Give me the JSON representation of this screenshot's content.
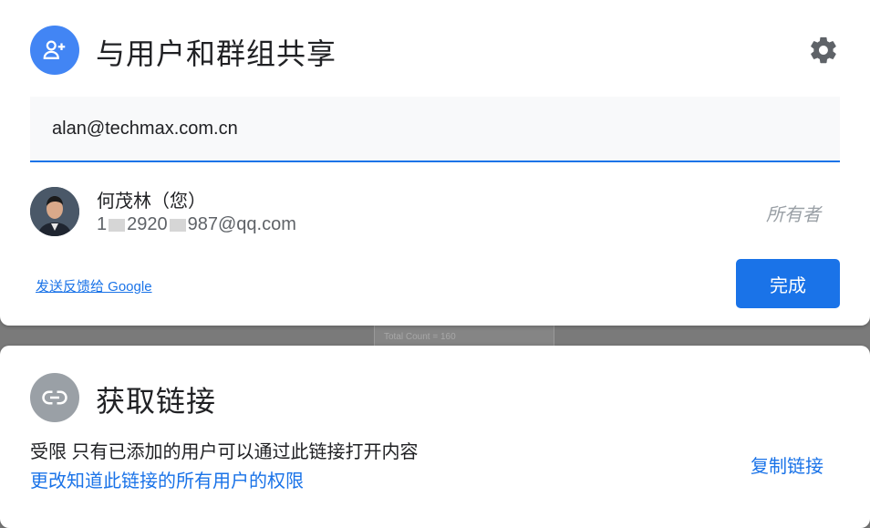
{
  "background_doc": {
    "text": "Total Count = 160"
  },
  "share": {
    "icon": "person-add-icon",
    "title": "与用户和群组共享",
    "settings_icon": "gear-icon",
    "email_input_value": "alan@techmax.com.cn",
    "user": {
      "name": "何茂林（您）",
      "email_prefix": "1",
      "email_mid": "2920",
      "email_suffix": "987@qq.com",
      "role": "所有者"
    },
    "feedback_link": "发送反馈给 Google",
    "done_button": "完成"
  },
  "link": {
    "icon": "link-icon",
    "title": "获取链接",
    "restriction": "受限 只有已添加的用户可以通过此链接打开内容",
    "change_link": "更改知道此链接的所有用户的权限",
    "copy_link": "复制链接"
  },
  "colors": {
    "accent": "#1a73e8",
    "share_icon_bg": "#4285f4",
    "link_icon_bg": "#9aa0a6"
  }
}
